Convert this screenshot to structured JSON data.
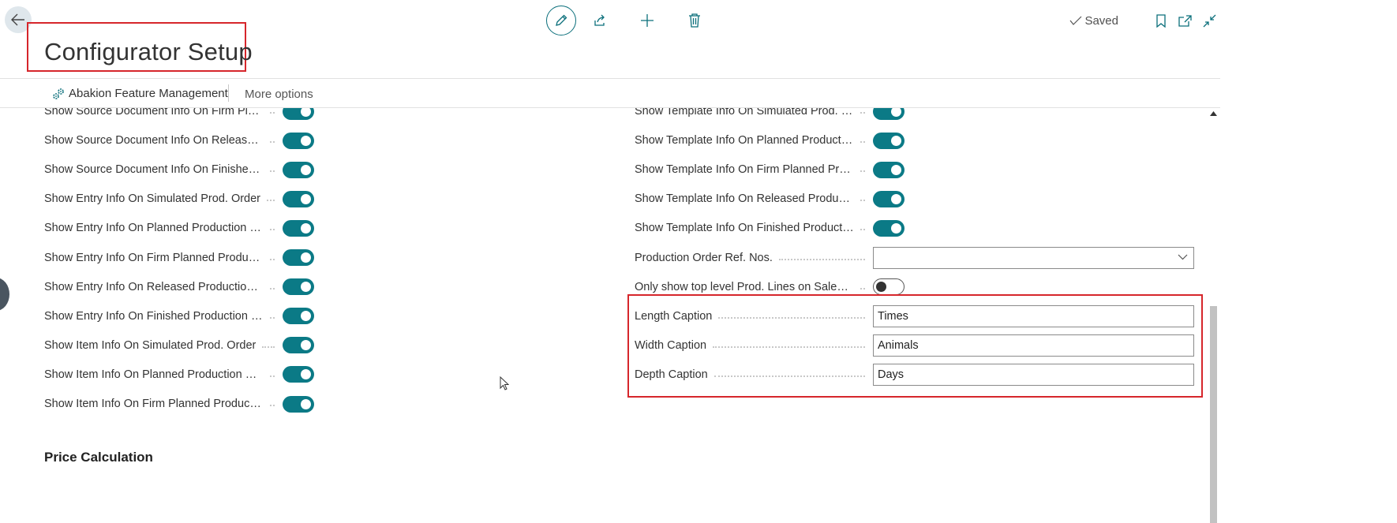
{
  "header": {
    "title": "Configurator Setup",
    "status": "Saved"
  },
  "actionbar": {
    "feature_management": "Abakion Feature Management",
    "more_options": "More options"
  },
  "left_fields": [
    {
      "label": "Show Source Document Info On Firm Planne...",
      "on": true
    },
    {
      "label": "Show Source Document Info On Released Pr...",
      "on": true
    },
    {
      "label": "Show Source Document Info On Finished Pro...",
      "on": true
    },
    {
      "label": "Show Entry Info On Simulated Prod. Order",
      "on": true
    },
    {
      "label": "Show Entry Info On Planned Production Order",
      "on": true
    },
    {
      "label": "Show Entry Info On Firm Planned Production...",
      "on": true
    },
    {
      "label": "Show Entry Info On Released Production Order",
      "on": true
    },
    {
      "label": "Show Entry Info On Finished Production Order",
      "on": true
    },
    {
      "label": "Show Item Info On Simulated Prod. Order",
      "on": true
    },
    {
      "label": "Show Item Info On Planned Production Order",
      "on": true
    },
    {
      "label": "Show Item Info On Firm Planned Production ...",
      "on": true
    }
  ],
  "right_fields": [
    {
      "label": "Show Template Info On Simulated Prod. Order",
      "type": "toggle",
      "on": true
    },
    {
      "label": "Show Template Info On Planned Production ...",
      "type": "toggle",
      "on": true
    },
    {
      "label": "Show Template Info On Firm Planned Produc...",
      "type": "toggle",
      "on": true
    },
    {
      "label": "Show Template Info On Released Production ...",
      "type": "toggle",
      "on": true
    },
    {
      "label": "Show Template Info On Finished Production ...",
      "type": "toggle",
      "on": true
    },
    {
      "label": "Production Order Ref. Nos.",
      "type": "select",
      "value": ""
    },
    {
      "label": "Only show top level Prod. Lines on Sales Doc...",
      "type": "toggle",
      "on": false
    },
    {
      "label": "Length Caption",
      "type": "text",
      "value": "Times"
    },
    {
      "label": "Width Caption",
      "type": "text",
      "value": "Animals"
    },
    {
      "label": "Depth Caption",
      "type": "text",
      "value": "Days"
    }
  ],
  "sections": {
    "next": "Price Calculation"
  },
  "colors": {
    "accent": "#0b7a86",
    "highlight": "#d6262b"
  }
}
